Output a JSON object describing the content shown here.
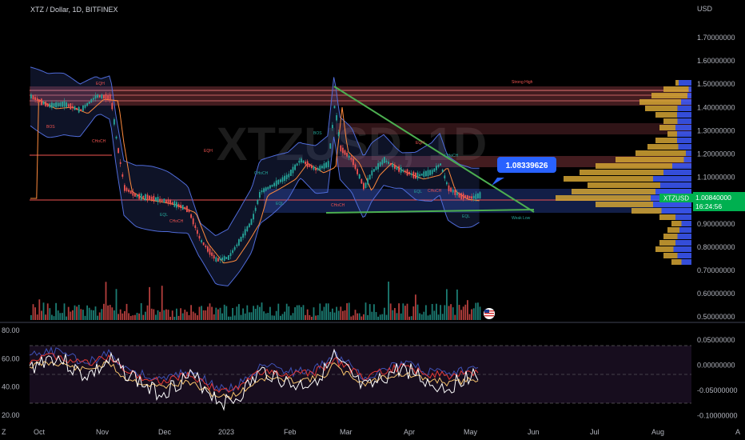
{
  "header": {
    "title": "XTZ / Dollar, 1D, BITFINEX"
  },
  "watermark": "XTZUSD, 1D",
  "price_axis": {
    "unit": "USD",
    "ticks": [
      "1.70000000",
      "1.60000000",
      "1.50000000",
      "1.40000000",
      "1.30000000",
      "1.20000000",
      "1.10000000",
      "1.00000000",
      "0.90000000",
      "0.80000000",
      "0.70000000",
      "0.60000000",
      "0.50000000"
    ]
  },
  "indicator_axis_left": {
    "ticks": [
      "80.00",
      "60.00",
      "40.00",
      "20.00"
    ]
  },
  "indicator_axis_right": {
    "ticks": [
      "0.05000000",
      "0.00000000",
      "-0.05000000",
      "-0.10000000"
    ]
  },
  "time_axis": {
    "labels": [
      "Oct",
      "Nov",
      "Dec",
      "2023",
      "Feb",
      "Mar",
      "Apr",
      "May",
      "Jun",
      "Jul",
      "Aug"
    ]
  },
  "corner_left": "Z",
  "corner_right": "A",
  "callout": {
    "value": "1.08339626"
  },
  "price_tag": {
    "symbol": "XTZUSD",
    "price": "1.00840000",
    "countdown": "16:24:56"
  },
  "annotations": {
    "strong_high": "Strong High",
    "weak_low": "Weak Low",
    "eqh": "EQH",
    "eql": "EQL",
    "bos": "BOS",
    "choch": "CHoCH"
  },
  "colors": {
    "up": "#26a69a",
    "down": "#ef5350",
    "band": "#4f6bd8",
    "triangle": "#4caf50",
    "callout": "#2962ff",
    "price_tag": "#00b050",
    "supply": "#e57373",
    "volume_profile_gold": "#d4a534",
    "volume_profile_blue": "#3d5afe"
  },
  "icons": {
    "flag": "us-flag-icon"
  }
}
